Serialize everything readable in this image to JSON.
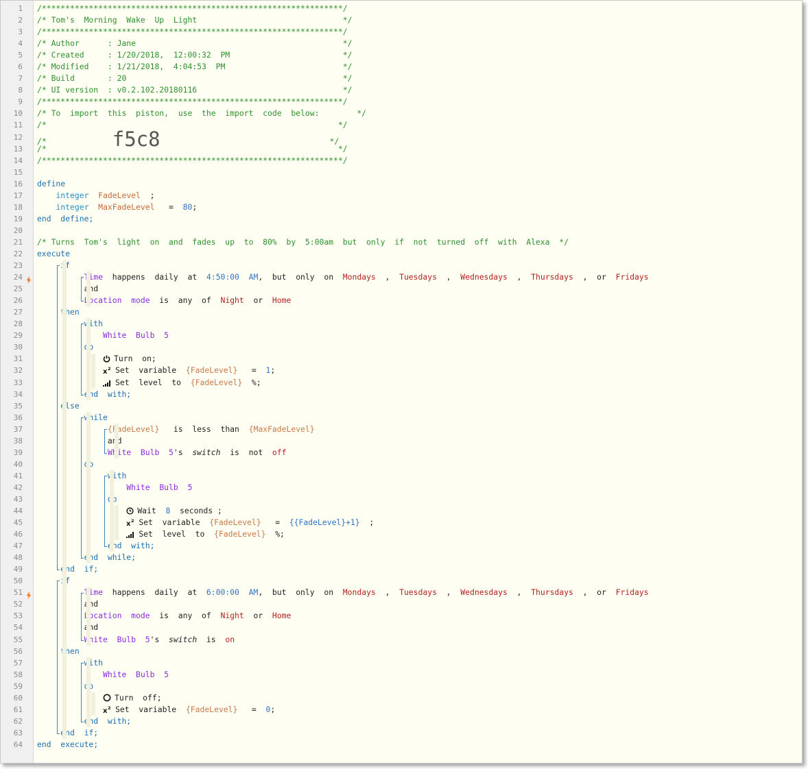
{
  "lines": [
    {
      "n": "1",
      "t": [
        [
          "c",
          "/****************************************************************/"
        ]
      ]
    },
    {
      "n": "2",
      "t": [
        [
          "c",
          "/* Tom's  Morning  Wake  Up  Light                               */"
        ]
      ]
    },
    {
      "n": "3",
      "t": [
        [
          "c",
          "/****************************************************************/"
        ]
      ]
    },
    {
      "n": "4",
      "t": [
        [
          "c",
          "/* Author      : Jane                                            */"
        ]
      ]
    },
    {
      "n": "5",
      "t": [
        [
          "c",
          "/* Created     : 1/20/2018,  12:00:32  PM                        */"
        ]
      ]
    },
    {
      "n": "6",
      "t": [
        [
          "c",
          "/* Modified    : 1/21/2018,  4:04:53  PM                         */"
        ]
      ]
    },
    {
      "n": "7",
      "t": [
        [
          "c",
          "/* Build       : 20                                              */"
        ]
      ]
    },
    {
      "n": "8",
      "t": [
        [
          "c",
          "/* UI version  : v0.2.102.20180116                               */"
        ]
      ]
    },
    {
      "n": "9",
      "t": [
        [
          "c",
          "/****************************************************************/"
        ]
      ]
    },
    {
      "n": "10",
      "t": [
        [
          "c",
          "/* To  import  this  piston,  use  the  import  code  below:        */"
        ]
      ]
    },
    {
      "n": "11",
      "t": [
        [
          "c",
          "/*                                                              */"
        ]
      ]
    },
    {
      "n": "12",
      "t": [
        [
          "c",
          "/*              "
        ],
        [
          "big",
          "f5c8"
        ],
        [
          "c",
          "                                    */"
        ]
      ]
    },
    {
      "n": "13",
      "t": [
        [
          "c",
          "/*                                                              */"
        ]
      ]
    },
    {
      "n": "14",
      "t": [
        [
          "c",
          "/****************************************************************/"
        ]
      ]
    },
    {
      "n": "15",
      "t": []
    },
    {
      "n": "16",
      "t": [
        [
          "kw",
          "define"
        ]
      ]
    },
    {
      "n": "17",
      "t": [
        [
          "pl",
          "    "
        ],
        [
          "ty",
          "integer"
        ],
        [
          "pl",
          "  "
        ],
        [
          "vn",
          "FadeLevel"
        ],
        [
          "pl",
          "  ;"
        ]
      ]
    },
    {
      "n": "18",
      "t": [
        [
          "pl",
          "    "
        ],
        [
          "ty",
          "integer"
        ],
        [
          "pl",
          "  "
        ],
        [
          "vn",
          "MaxFadeLevel"
        ],
        [
          "pl",
          "   =  "
        ],
        [
          "nm",
          "80"
        ],
        [
          "pl",
          ";"
        ]
      ]
    },
    {
      "n": "19",
      "t": [
        [
          "kw",
          "end  define;"
        ]
      ]
    },
    {
      "n": "20",
      "t": []
    },
    {
      "n": "21",
      "t": [
        [
          "c",
          "/* Turns  Tom's  light  on  and  fades  up  to  80%  by  5:00am  but  only  if  not  turned  off  with  Alexa  */"
        ]
      ]
    },
    {
      "n": "22",
      "t": [
        [
          "kw",
          "execute"
        ]
      ]
    },
    {
      "n": "23",
      "t": [
        [
          "pl",
          "     "
        ],
        [
          "kw",
          "if"
        ]
      ]
    },
    {
      "n": "24",
      "bolt": true,
      "t": [
        [
          "pl",
          "          "
        ],
        [
          "dv",
          "Time"
        ],
        [
          "pl",
          "  happens  daily  at  "
        ],
        [
          "nm",
          "4:50:00  AM"
        ],
        [
          "pl",
          ",  but  only  on  "
        ],
        [
          "st",
          "Mondays"
        ],
        [
          "pl",
          "  ,  "
        ],
        [
          "st",
          "Tuesdays"
        ],
        [
          "pl",
          "  ,  "
        ],
        [
          "st",
          "Wednesdays"
        ],
        [
          "pl",
          "  ,  "
        ],
        [
          "st",
          "Thursdays"
        ],
        [
          "pl",
          "  ,  or  "
        ],
        [
          "st",
          "Fridays"
        ]
      ]
    },
    {
      "n": "25",
      "t": [
        [
          "pl",
          "          and"
        ]
      ]
    },
    {
      "n": "26",
      "t": [
        [
          "pl",
          "          "
        ],
        [
          "dv",
          "Location  mode"
        ],
        [
          "pl",
          "  is  any  of  "
        ],
        [
          "st",
          "Night"
        ],
        [
          "pl",
          "  or  "
        ],
        [
          "st",
          "Home"
        ]
      ]
    },
    {
      "n": "27",
      "t": [
        [
          "pl",
          "     "
        ],
        [
          "kw",
          "then"
        ]
      ]
    },
    {
      "n": "28",
      "t": [
        [
          "pl",
          "          "
        ],
        [
          "kw",
          "with"
        ]
      ]
    },
    {
      "n": "29",
      "t": [
        [
          "pl",
          "              "
        ],
        [
          "dv",
          "White  Bulb  5"
        ]
      ]
    },
    {
      "n": "30",
      "t": [
        [
          "pl",
          "          "
        ],
        [
          "kw",
          "do"
        ]
      ]
    },
    {
      "n": "31",
      "t": [
        [
          "pl",
          "              "
        ],
        [
          "icon",
          "power"
        ],
        [
          "pl",
          "Turn  on;"
        ]
      ]
    },
    {
      "n": "32",
      "t": [
        [
          "pl",
          "              "
        ],
        [
          "icon",
          "x2"
        ],
        [
          "pl",
          "Set  variable  "
        ],
        [
          "vr",
          "{FadeLevel}"
        ],
        [
          "pl",
          "   =  "
        ],
        [
          "nm",
          "1"
        ],
        [
          "pl",
          ";"
        ]
      ]
    },
    {
      "n": "33",
      "t": [
        [
          "pl",
          "              "
        ],
        [
          "icon",
          "level"
        ],
        [
          "pl",
          "Set  level  to  "
        ],
        [
          "vr",
          "{FadeLevel}"
        ],
        [
          "pl",
          "  %;"
        ]
      ]
    },
    {
      "n": "34",
      "t": [
        [
          "pl",
          "          "
        ],
        [
          "kw",
          "end  with;"
        ]
      ]
    },
    {
      "n": "35",
      "t": [
        [
          "pl",
          "     "
        ],
        [
          "kw",
          "else"
        ]
      ]
    },
    {
      "n": "36",
      "t": [
        [
          "pl",
          "          "
        ],
        [
          "kw",
          "while"
        ]
      ]
    },
    {
      "n": "37",
      "t": [
        [
          "pl",
          "               "
        ],
        [
          "vr",
          "{FadeLevel}"
        ],
        [
          "pl",
          "   is  less  than  "
        ],
        [
          "vr",
          "{MaxFadeLevel}"
        ]
      ]
    },
    {
      "n": "38",
      "t": [
        [
          "pl",
          "               and"
        ]
      ]
    },
    {
      "n": "39",
      "t": [
        [
          "pl",
          "               "
        ],
        [
          "dv",
          "White  Bulb  5"
        ],
        [
          "pl",
          "'s  "
        ],
        [
          "em",
          "switch"
        ],
        [
          "pl",
          "  is  not  "
        ],
        [
          "st",
          "off"
        ]
      ]
    },
    {
      "n": "40",
      "t": [
        [
          "pl",
          "          "
        ],
        [
          "kw",
          "do"
        ]
      ]
    },
    {
      "n": "41",
      "t": [
        [
          "pl",
          "               "
        ],
        [
          "kw",
          "with"
        ]
      ]
    },
    {
      "n": "42",
      "t": [
        [
          "pl",
          "                   "
        ],
        [
          "dv",
          "White  Bulb  5"
        ]
      ]
    },
    {
      "n": "43",
      "t": [
        [
          "pl",
          "               "
        ],
        [
          "kw",
          "do"
        ]
      ]
    },
    {
      "n": "44",
      "t": [
        [
          "pl",
          "                   "
        ],
        [
          "icon",
          "clock"
        ],
        [
          "pl",
          "Wait  "
        ],
        [
          "nm",
          "8"
        ],
        [
          "pl",
          "  seconds ;"
        ]
      ]
    },
    {
      "n": "45",
      "t": [
        [
          "pl",
          "                   "
        ],
        [
          "icon",
          "x2"
        ],
        [
          "pl",
          "Set  variable  "
        ],
        [
          "vr",
          "{FadeLevel}"
        ],
        [
          "pl",
          "   =  "
        ],
        [
          "nm",
          "{{FadeLevel}+1}"
        ],
        [
          "pl",
          "  ;"
        ]
      ]
    },
    {
      "n": "46",
      "t": [
        [
          "pl",
          "                   "
        ],
        [
          "icon",
          "level"
        ],
        [
          "pl",
          "Set  level  to  "
        ],
        [
          "vr",
          "{FadeLevel}"
        ],
        [
          "pl",
          "  %;"
        ]
      ]
    },
    {
      "n": "47",
      "t": [
        [
          "pl",
          "               "
        ],
        [
          "kw",
          "end  with;"
        ]
      ]
    },
    {
      "n": "48",
      "t": [
        [
          "pl",
          "          "
        ],
        [
          "kw",
          "end  while;"
        ]
      ]
    },
    {
      "n": "49",
      "t": [
        [
          "pl",
          "     "
        ],
        [
          "kw",
          "end  if;"
        ]
      ]
    },
    {
      "n": "50",
      "t": [
        [
          "pl",
          "     "
        ],
        [
          "kw",
          "if"
        ]
      ]
    },
    {
      "n": "51",
      "bolt": true,
      "t": [
        [
          "pl",
          "          "
        ],
        [
          "dv",
          "Time"
        ],
        [
          "pl",
          "  happens  daily  at  "
        ],
        [
          "nm",
          "6:00:00  AM"
        ],
        [
          "pl",
          ",  but  only  on  "
        ],
        [
          "st",
          "Mondays"
        ],
        [
          "pl",
          "  ,  "
        ],
        [
          "st",
          "Tuesdays"
        ],
        [
          "pl",
          "  ,  "
        ],
        [
          "st",
          "Wednesdays"
        ],
        [
          "pl",
          "  ,  "
        ],
        [
          "st",
          "Thursdays"
        ],
        [
          "pl",
          "  ,  or  "
        ],
        [
          "st",
          "Fridays"
        ]
      ]
    },
    {
      "n": "52",
      "t": [
        [
          "pl",
          "          and"
        ]
      ]
    },
    {
      "n": "53",
      "t": [
        [
          "pl",
          "          "
        ],
        [
          "dv",
          "Location  mode"
        ],
        [
          "pl",
          "  is  any  of  "
        ],
        [
          "st",
          "Night"
        ],
        [
          "pl",
          "  or  "
        ],
        [
          "st",
          "Home"
        ]
      ]
    },
    {
      "n": "54",
      "t": [
        [
          "pl",
          "          and"
        ]
      ]
    },
    {
      "n": "55",
      "t": [
        [
          "pl",
          "          "
        ],
        [
          "dv",
          "White  Bulb  5"
        ],
        [
          "pl",
          "'s  "
        ],
        [
          "em",
          "switch"
        ],
        [
          "pl",
          "  is  "
        ],
        [
          "st",
          "on"
        ]
      ]
    },
    {
      "n": "56",
      "t": [
        [
          "pl",
          "     "
        ],
        [
          "kw",
          "then"
        ]
      ]
    },
    {
      "n": "57",
      "t": [
        [
          "pl",
          "          "
        ],
        [
          "kw",
          "with"
        ]
      ]
    },
    {
      "n": "58",
      "t": [
        [
          "pl",
          "              "
        ],
        [
          "dv",
          "White  Bulb  5"
        ]
      ]
    },
    {
      "n": "59",
      "t": [
        [
          "pl",
          "          "
        ],
        [
          "kw",
          "do"
        ]
      ]
    },
    {
      "n": "60",
      "t": [
        [
          "pl",
          "              "
        ],
        [
          "icon",
          "off"
        ],
        [
          "pl",
          "Turn  off;"
        ]
      ]
    },
    {
      "n": "61",
      "t": [
        [
          "pl",
          "              "
        ],
        [
          "icon",
          "x2"
        ],
        [
          "pl",
          "Set  variable  "
        ],
        [
          "vr",
          "{FadeLevel}"
        ],
        [
          "pl",
          "   =  "
        ],
        [
          "nm",
          "0"
        ],
        [
          "pl",
          ";"
        ]
      ]
    },
    {
      "n": "62",
      "t": [
        [
          "pl",
          "          "
        ],
        [
          "kw",
          "end  with;"
        ]
      ]
    },
    {
      "n": "63",
      "t": [
        [
          "pl",
          "     "
        ],
        [
          "kw",
          "end  if;"
        ]
      ]
    },
    {
      "n": "64",
      "t": [
        [
          "kw",
          "end  execute;"
        ]
      ]
    }
  ]
}
